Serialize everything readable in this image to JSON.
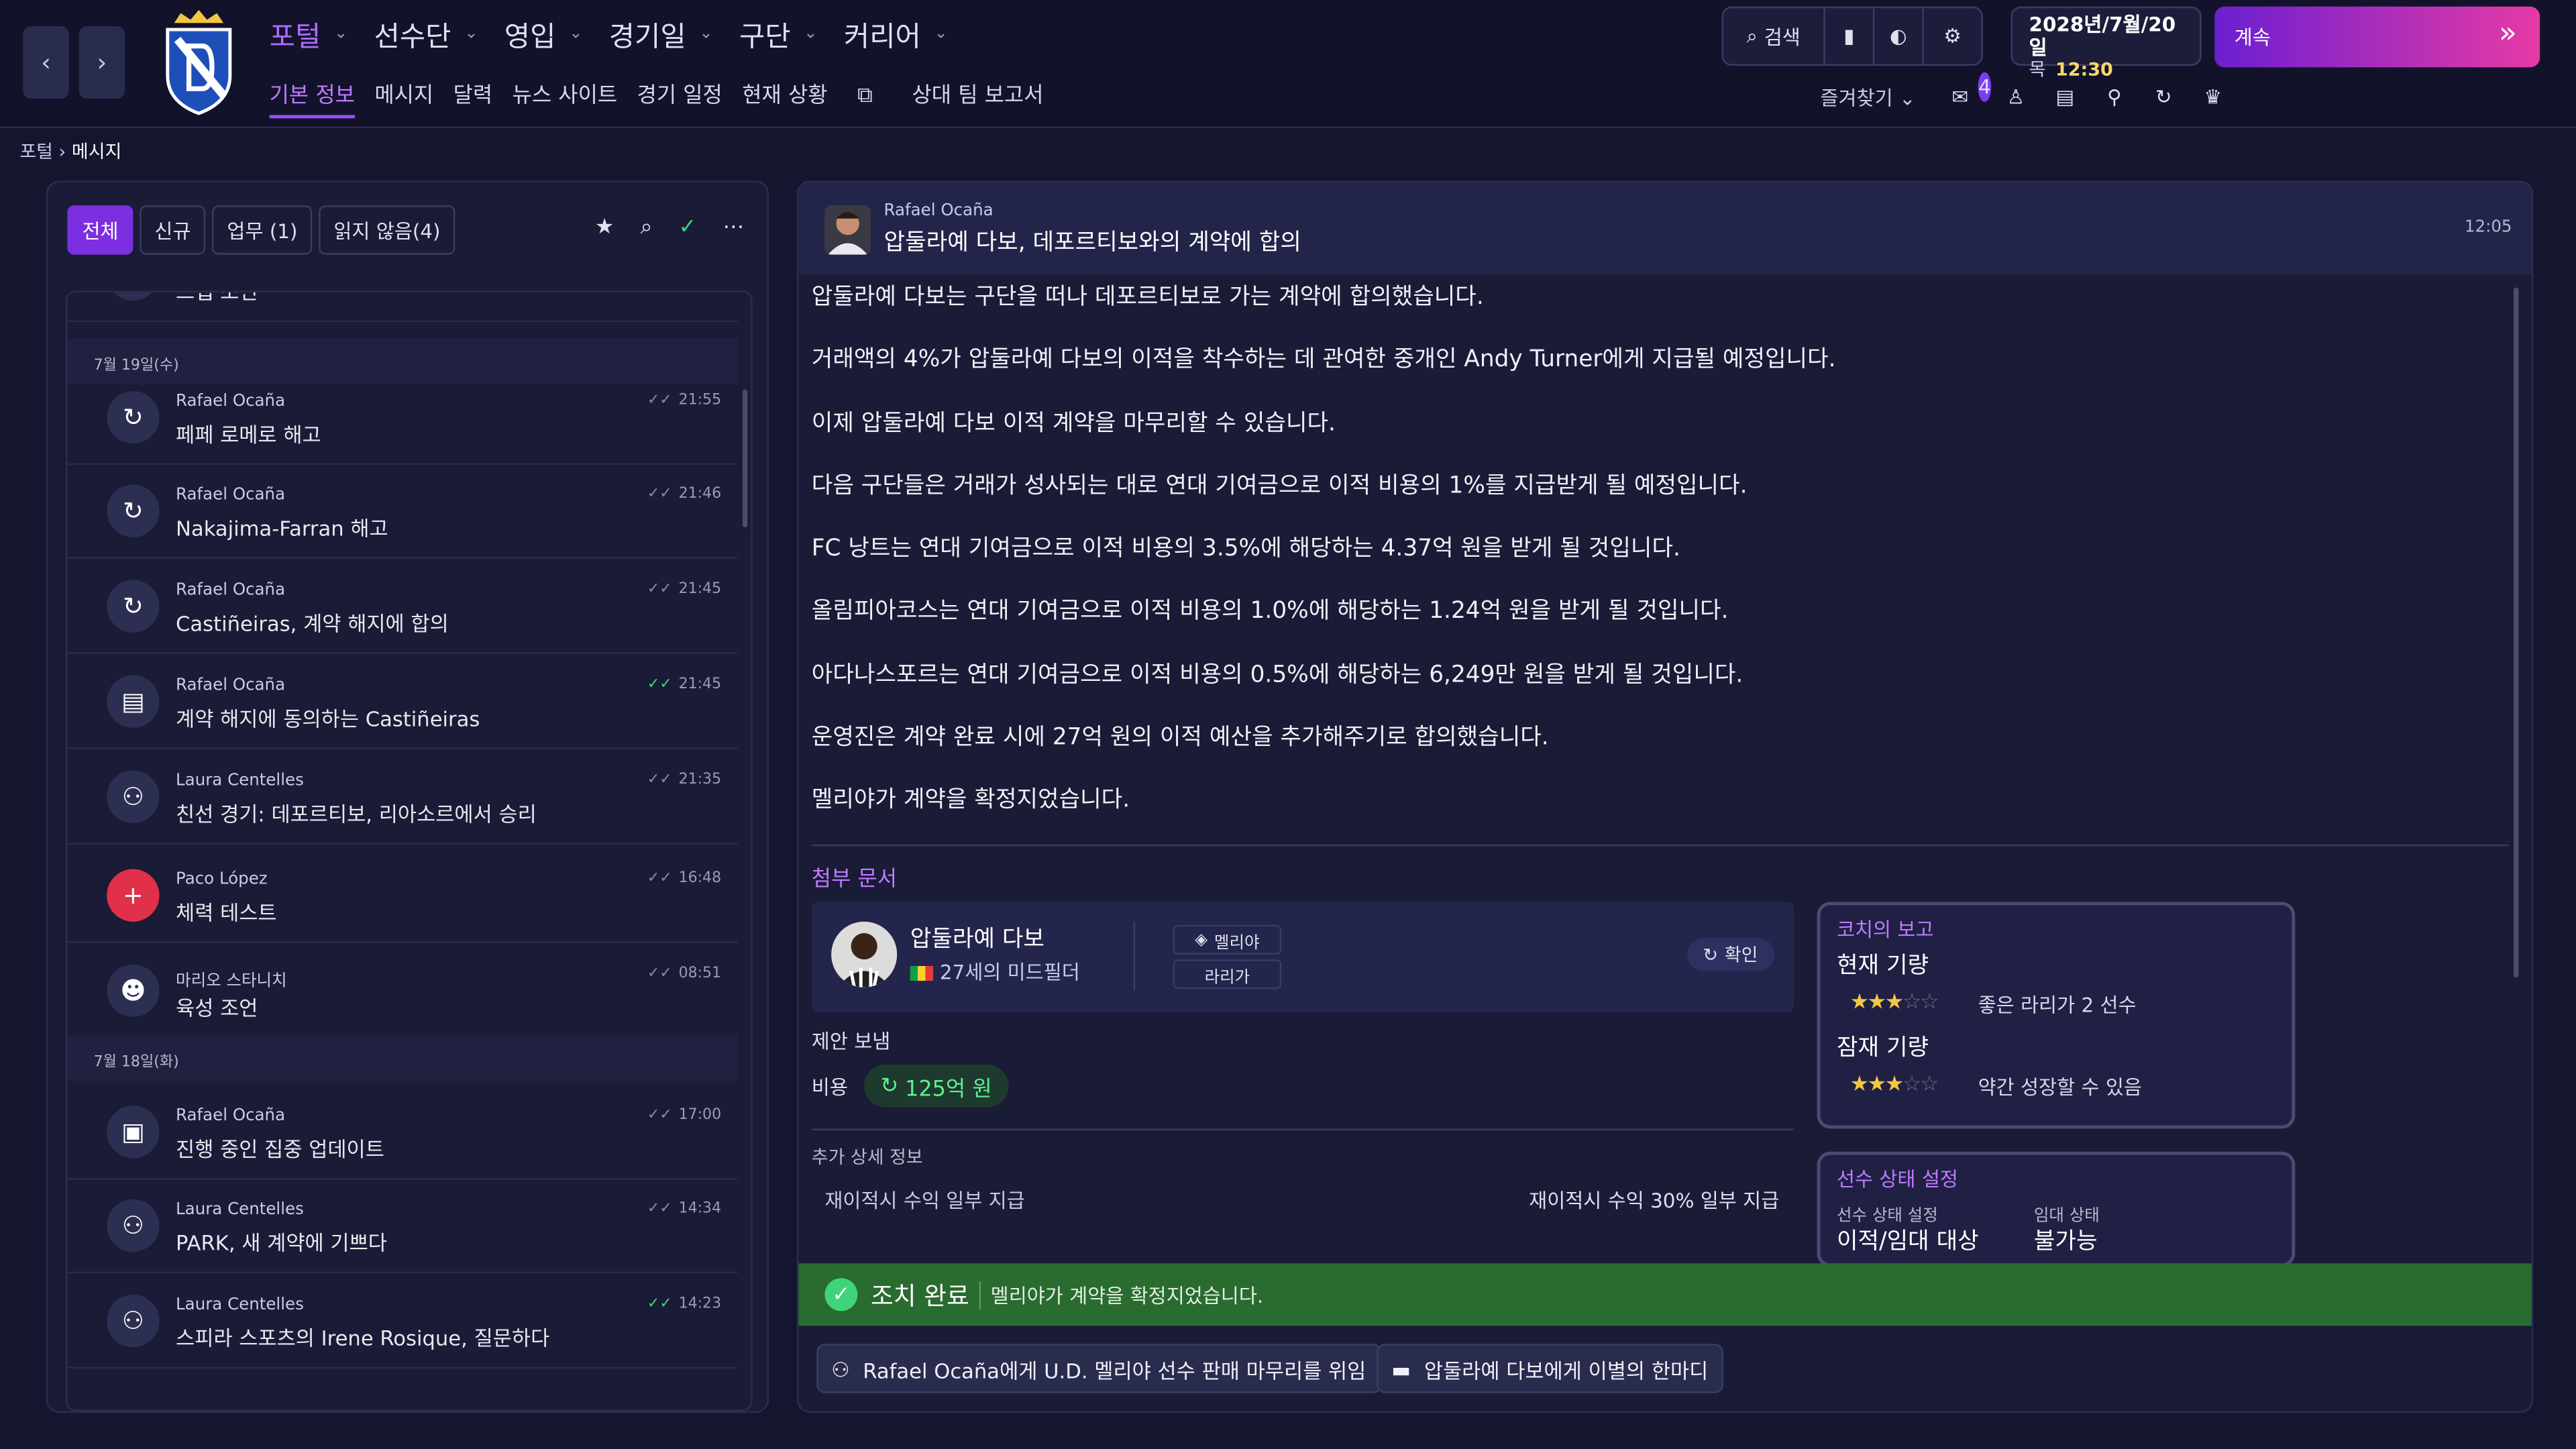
{
  "nav": {
    "back": "‹",
    "forward": "›"
  },
  "menu": [
    {
      "label": "포털",
      "active": true
    },
    {
      "label": "선수단"
    },
    {
      "label": "영입"
    },
    {
      "label": "경기일"
    },
    {
      "label": "구단"
    },
    {
      "label": "커리어"
    }
  ],
  "submenu": [
    "기본 정보",
    "메시지",
    "달력",
    "뉴스 사이트",
    "경기 일정",
    "현재 상황",
    "상대 팀 보고서"
  ],
  "tools": {
    "search": "검색"
  },
  "date": {
    "date": "2028년/7월/20일",
    "weekday": "목",
    "time": "12:30"
  },
  "continue_label": "계속",
  "favorites": "즐겨찾기",
  "notif_count": "4",
  "breadcrumb": {
    "root": "포털",
    "current": "메시지"
  },
  "filters": {
    "all": "전체",
    "new": "신규",
    "task": "업무 (1)",
    "unread": "읽지 않음(4)"
  },
  "list": {
    "top_partial": "스탭 조언",
    "date1": "7월 19일(수)",
    "date2": "7월 18일(화)",
    "items": [
      {
        "sender": "Rafael Ocaña",
        "subject": "페페 로메로 해고",
        "time": "21:55",
        "read_green": false,
        "icon": "↻"
      },
      {
        "sender": "Rafael Ocaña",
        "subject": "Nakajima-Farran 해고",
        "time": "21:46",
        "read_green": false,
        "icon": "↻"
      },
      {
        "sender": "Rafael Ocaña",
        "subject": "Castiñeiras, 계약 해지에 합의",
        "time": "21:45",
        "read_green": false,
        "icon": "↻"
      },
      {
        "sender": "Rafael Ocaña",
        "subject": "계약 해지에 동의하는 Castiñeiras",
        "time": "21:45",
        "read_green": true,
        "icon": "▤"
      },
      {
        "sender": "Laura Centelles",
        "subject": "친선 경기: 데포르티보, 리아소르에서 승리",
        "time": "21:35",
        "read_green": false,
        "icon": "⚇"
      },
      {
        "sender": "Paco López",
        "subject": "체력 테스트",
        "time": "16:48",
        "read_green": false,
        "icon": "+"
      },
      {
        "sender": "마리오 스타니치",
        "subject": "육성 조언",
        "time": "08:51",
        "read_green": false,
        "icon": "☻"
      },
      {
        "sender": "Rafael Ocaña",
        "subject": "진행 중인 집중 업데이트",
        "time": "17:00",
        "read_green": false,
        "icon": "▣"
      },
      {
        "sender": "Laura Centelles",
        "subject": "PARK, 새 계약에 기쁘다",
        "time": "14:34",
        "read_green": false,
        "icon": "⚇"
      },
      {
        "sender": "Laura Centelles",
        "subject": "스피라 스포츠의 Irene Rosique, 질문하다",
        "time": "14:23",
        "read_green": true,
        "icon": "⚇"
      }
    ]
  },
  "message": {
    "from": "Rafael Ocaña",
    "subject": "압둘라예 다보, 데포르티보와의 계약에 합의",
    "time": "12:05",
    "paragraphs": [
      "압둘라예 다보는 구단을 떠나 데포르티보로 가는 계약에 합의했습니다.",
      "거래액의 4%가 압둘라예 다보의 이적을 착수하는 데 관여한 중개인 Andy Turner에게 지급될 예정입니다.",
      "이제 압둘라예 다보 이적 계약을 마무리할 수 있습니다.",
      "다음 구단들은 거래가 성사되는 대로 연대 기여금으로 이적 비용의 1%를 지급받게 될 예정입니다.",
      "FC 낭트는 연대 기여금으로 이적 비용의 3.5%에 해당하는 4.37억 원을 받게 될 것입니다.",
      "올림피아코스는 연대 기여금으로 이적 비용의 1.0%에 해당하는 1.24억 원을 받게 될 것입니다.",
      "아다나스포르는 연대 기여금으로 이적 비용의 0.5%에 해당하는 6,249만 원을 받게 될 것입니다.",
      "운영진은 계약 완료 시에 27억 원의 이적 예산을 추가해주기로 합의했습니다.",
      "멜리야가 계약을 확정지었습니다."
    ],
    "attach_label": "첨부 문서",
    "player": {
      "name": "압둘라예 다보",
      "desc": "27세의 미드필더",
      "club": "멜리야",
      "league": "라리가",
      "confirm": "확인"
    },
    "offer_label": "제안 보냄",
    "cost_label": "비용",
    "cost_value": "125억 원",
    "details_label": "추가 상세 정보",
    "detail_left": "재이적시 수익 일부 지급",
    "detail_right": "재이적시 수익 30% 일부 지급",
    "coach": {
      "title": "코치의 보고",
      "current_label": "현재 기량",
      "current_stars": 3,
      "current_text": "좋은 라리가 2 선수",
      "potential_label": "잠재 기량",
      "potential_stars": 3,
      "potential_text": "약간 성장할 수 있음"
    },
    "status": {
      "title": "선수 상태 설정",
      "l1": "선수 상태 설정",
      "v1": "이적/임대 대상",
      "l2": "임대 상태",
      "v2": "불가능"
    },
    "done_title": "조치 완료",
    "done_msg": "멜리야가 계약을 확정지었습니다.",
    "action1": "Rafael Ocaña에게 U.D. 멜리야 선수 판매 마무리를 위임",
    "action2": "압둘라예 다보에게 이별의 한마디"
  },
  "colors": {
    "accent": "#9b4dff",
    "done": "#2a6b30",
    "continue_from": "#6b1fd0",
    "continue_to": "#e63aa6"
  }
}
